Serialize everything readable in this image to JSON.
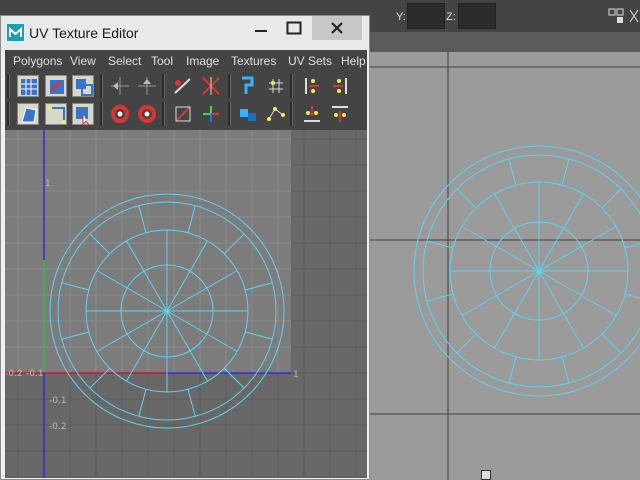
{
  "window": {
    "title": "UV Texture Editor",
    "minimize_icon": "minimize-icon",
    "maximize_icon": "maximize-icon",
    "close_icon": "close-icon"
  },
  "menubar": {
    "items": [
      "Polygons",
      "View",
      "Select",
      "Tool",
      "Image",
      "Textures",
      "UV Sets",
      "Help"
    ]
  },
  "topbar": {
    "y_label": "Y:",
    "z_label": "Z:"
  },
  "uv_grid": {
    "left_labels": [
      "-0.2",
      "-0.1"
    ],
    "below_labels": [
      "-0.1",
      "-0.2"
    ],
    "top_mark": "1",
    "right_mark": "1"
  },
  "colors": {
    "wire": "#5fd3f0",
    "u_axis": "#d22020",
    "v_axis": "#2f2fd6",
    "v_axis_green": "#3ec83e"
  }
}
